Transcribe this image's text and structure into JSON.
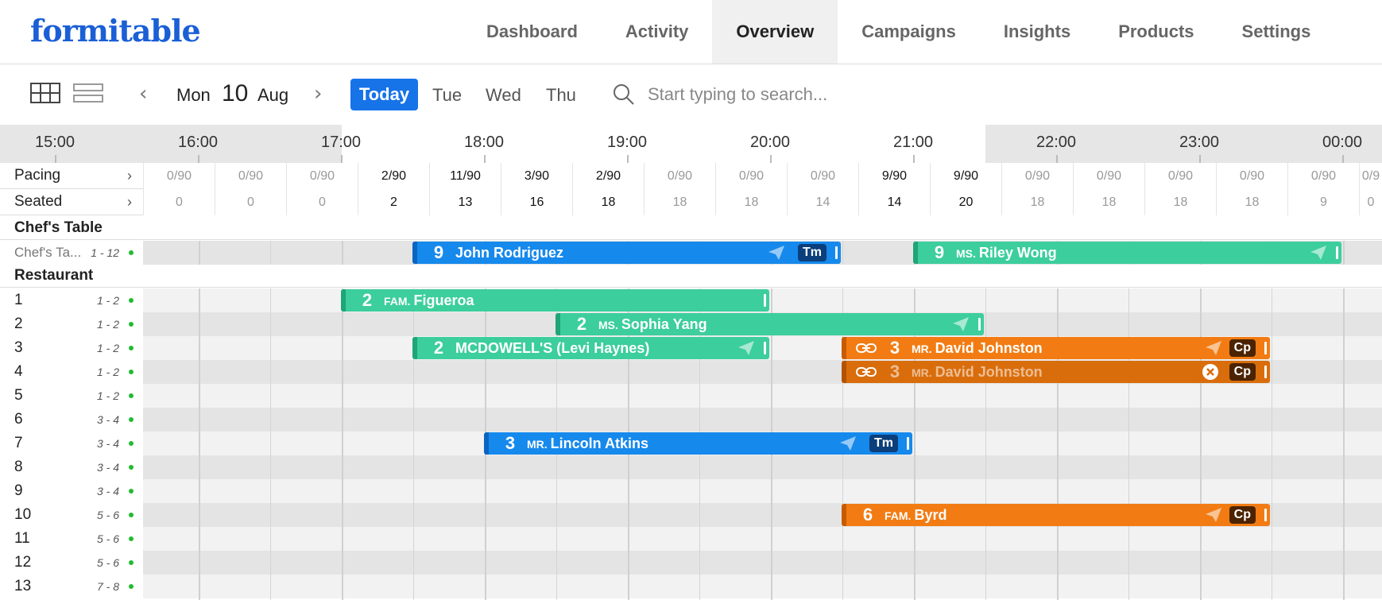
{
  "app": {
    "logo": "formitable"
  },
  "nav": [
    {
      "label": "Dashboard"
    },
    {
      "label": "Activity"
    },
    {
      "label": "Overview",
      "active": true
    },
    {
      "label": "Campaigns"
    },
    {
      "label": "Insights"
    },
    {
      "label": "Products"
    },
    {
      "label": "Settings"
    }
  ],
  "toolbar": {
    "date_dow": "Mon",
    "date_num": "10",
    "date_month": "Aug",
    "today": "Today",
    "days": [
      "Tue",
      "Wed",
      "Thu"
    ],
    "search_placeholder": "Start typing to search..."
  },
  "timeline": {
    "hours": [
      "15:00",
      "16:00",
      "17:00",
      "18:00",
      "19:00",
      "20:00",
      "21:00",
      "22:00",
      "23:00",
      "00:00"
    ],
    "pacing_label": "Pacing",
    "seated_label": "Seated",
    "pacing": [
      "0/90",
      "0/90",
      "0/90",
      "2/90",
      "11/90",
      "3/90",
      "2/90",
      "0/90",
      "0/90",
      "0/90",
      "9/90",
      "9/90",
      "0/90",
      "0/90",
      "0/90",
      "0/90",
      "0/90",
      "0/9"
    ],
    "seated": [
      "0",
      "0",
      "0",
      "2",
      "13",
      "16",
      "18",
      "18",
      "18",
      "14",
      "14",
      "20",
      "18",
      "18",
      "18",
      "18",
      "9",
      "0"
    ],
    "pacing_bright": [
      false,
      false,
      false,
      true,
      true,
      true,
      true,
      false,
      false,
      false,
      true,
      true,
      false,
      false,
      false,
      false,
      false,
      false
    ]
  },
  "sections": {
    "chefs_table": "Chef's Table",
    "restaurant": "Restaurant"
  },
  "tables": {
    "chefs": {
      "name": "Chef's Ta...",
      "capacity": "1 - 12"
    },
    "restaurant": [
      {
        "name": "1",
        "capacity": "1 - 2"
      },
      {
        "name": "2",
        "capacity": "1 - 2"
      },
      {
        "name": "3",
        "capacity": "1 - 2"
      },
      {
        "name": "4",
        "capacity": "1 - 2"
      },
      {
        "name": "5",
        "capacity": "1 - 2"
      },
      {
        "name": "6",
        "capacity": "3 - 4"
      },
      {
        "name": "7",
        "capacity": "3 - 4"
      },
      {
        "name": "8",
        "capacity": "3 - 4"
      },
      {
        "name": "9",
        "capacity": "3 - 4"
      },
      {
        "name": "10",
        "capacity": "5 - 6"
      },
      {
        "name": "11",
        "capacity": "5 - 6"
      },
      {
        "name": "12",
        "capacity": "5 - 6"
      },
      {
        "name": "13",
        "capacity": "7 - 8"
      }
    ]
  },
  "bookings": {
    "rodriguez": {
      "count": "9",
      "prefix": "",
      "name": "John Rodriguez",
      "badge": "Tm"
    },
    "wong": {
      "count": "9",
      "prefix": "MS.",
      "name": "Riley Wong"
    },
    "figueroa": {
      "count": "2",
      "prefix": "FAM.",
      "name": "Figueroa"
    },
    "yang": {
      "count": "2",
      "prefix": "MS.",
      "name": "Sophia Yang"
    },
    "mcdowell": {
      "count": "2",
      "prefix": "",
      "name": "MCDOWELL'S (Levi Haynes)"
    },
    "johnston1": {
      "count": "3",
      "prefix": "MR.",
      "name": "David Johnston",
      "badge": "Cp"
    },
    "johnston2": {
      "count": "3",
      "prefix": "MR.",
      "name": "David Johnston",
      "badge": "Cp"
    },
    "atkins": {
      "count": "3",
      "prefix": "MR.",
      "name": "Lincoln Atkins",
      "badge": "Tm"
    },
    "byrd": {
      "count": "6",
      "prefix": "FAM.",
      "name": "Byrd",
      "badge": "Cp"
    }
  },
  "colors": {
    "brand": "#1a5fd6",
    "today": "#1773e8",
    "blue_booking": "#1689ec",
    "green_booking": "#3cce9c",
    "orange_booking": "#f27c13"
  }
}
